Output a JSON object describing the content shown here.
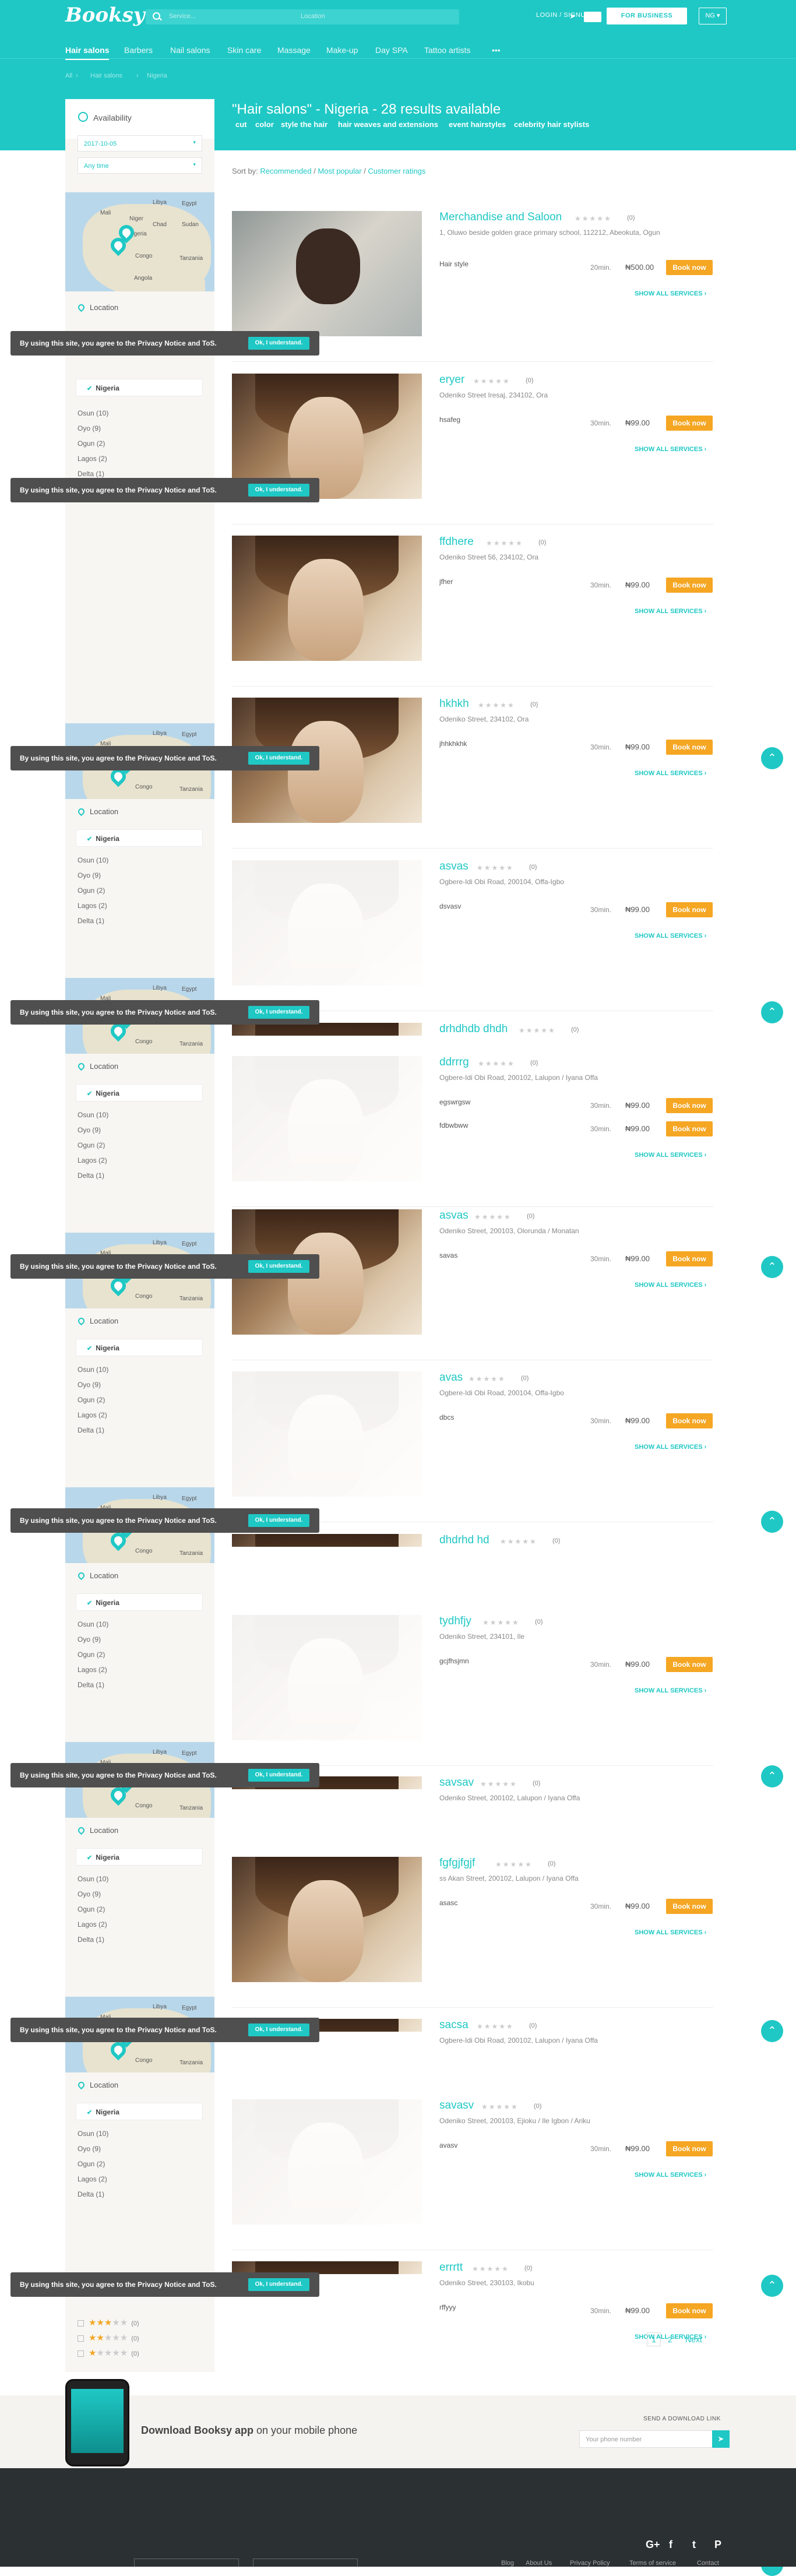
{
  "header": {
    "logo": "Booksy",
    "search_placeholder": "Service...",
    "location_placeholder": "Location",
    "login": "LOGIN / SIGNUP",
    "for_business": "FOR BUSINESS",
    "lang": "NG ▾"
  },
  "nav": [
    "Hair salons",
    "Barbers",
    "Nail salons",
    "Skin care",
    "Massage",
    "Make-up",
    "Day SPA",
    "Tattoo artists",
    "•••"
  ],
  "breadcrumb": [
    "All",
    "Hair salons",
    "Nigeria"
  ],
  "results_title": "\"Hair salons\" - Nigeria - 28 results available",
  "tags": [
    "cut",
    "color",
    "style the hair",
    "hair weaves and extensions",
    "event hairstyles",
    "celebrity hair stylists"
  ],
  "filters": {
    "availability": "Availability",
    "date": "2017-10-05",
    "time": "Any time",
    "location": "Location",
    "country": "Nigeria",
    "regions": [
      "Osun (10)",
      "Oyo (9)",
      "Ogun (2)",
      "Lagos (2)",
      "Delta (1)"
    ],
    "star_counts": [
      "(0)",
      "(0)",
      "(0)"
    ]
  },
  "map": {
    "labels": [
      "Libya",
      "Egypt",
      "Niger",
      "Chad",
      "Sudan",
      "Nigeria",
      "Congo",
      "Angola",
      "Tanzania",
      "Mali"
    ]
  },
  "sort": {
    "label": "Sort by:",
    "options": [
      "Recommended",
      "Most popular",
      "Customer ratings"
    ]
  },
  "toast": {
    "text": "By using this site, you agree to the Privacy Notice and ToS.",
    "ok": "Ok, I understand."
  },
  "listings": [
    {
      "name": "Merchandise and Saloon",
      "rating": "(0)",
      "address": "1, Oluwo beside golden grace primary school, 112212, Abeokuta, Ogun",
      "services": [
        {
          "name": "Hair style",
          "duration": "20min.",
          "price": "₦500.00"
        }
      ]
    },
    {
      "name": "eryer",
      "rating": "(0)",
      "address": "Odeniko Street Iresaj, 234102, Ora",
      "services": [
        {
          "name": "hsafeg",
          "duration": "30min.",
          "price": "₦99.00"
        }
      ]
    },
    {
      "name": "ffdhere",
      "rating": "(0)",
      "address": "Odeniko Street 56, 234102, Ora",
      "services": [
        {
          "name": "jfher",
          "duration": "30min.",
          "price": "₦99.00"
        }
      ]
    },
    {
      "name": "hkhkh",
      "rating": "(0)",
      "address": "Odeniko Street, 234102, Ora",
      "services": [
        {
          "name": "jhhkhkhk",
          "duration": "30min.",
          "price": "₦99.00"
        }
      ]
    },
    {
      "name": "asvas",
      "rating": "(0)",
      "address": "Ogbere-Idi Obi Road, 200104, Offa-Igbo",
      "services": [
        {
          "name": "dsvasv",
          "duration": "30min.",
          "price": "₦99.00"
        }
      ]
    },
    {
      "name": "drhdhdb dhdh",
      "rating": "(0)",
      "address": "",
      "services": []
    },
    {
      "name": "ddrrrg",
      "rating": "(0)",
      "address": "Ogbere-Idi Obi Road, 200102, Lalupon / Iyana Offa",
      "services": [
        {
          "name": "egswrgsw",
          "duration": "30min.",
          "price": "₦99.00"
        },
        {
          "name": "fdbwbww",
          "duration": "30min.",
          "price": "₦99.00"
        }
      ]
    },
    {
      "name": "asvas",
      "rating": "(0)",
      "address": "Odeniko Street, 200103, Olorunda / Monatan",
      "services": [
        {
          "name": "savas",
          "duration": "30min.",
          "price": "₦99.00"
        }
      ]
    },
    {
      "name": "avas",
      "rating": "(0)",
      "address": "Ogbere-Idi Obi Road, 200104, Offa-Igbo",
      "services": [
        {
          "name": "dbcs",
          "duration": "30min.",
          "price": "₦99.00"
        }
      ]
    },
    {
      "name": "dhdrhd hd",
      "rating": "(0)",
      "address": "",
      "services": []
    },
    {
      "name": "tydhfjy",
      "rating": "(0)",
      "address": "Odeniko Street, 234101, Ile",
      "services": [
        {
          "name": "gcjfhsjmn",
          "duration": "30min.",
          "price": "₦99.00"
        }
      ]
    },
    {
      "name": "savsav",
      "rating": "(0)",
      "address": "Odeniko Street, 200102, Lalupon / Iyana Offa",
      "services": []
    },
    {
      "name": "fgfgjfgjf",
      "rating": "(0)",
      "address": "ss Akan Street, 200102, Lalupon / Iyana Offa",
      "services": [
        {
          "name": "asasc",
          "duration": "30min.",
          "price": "₦99.00"
        }
      ]
    },
    {
      "name": "sacsa",
      "rating": "(0)",
      "address": "Ogbere-Idi Obi Road, 200102, Lalupon / Iyana Offa",
      "services": []
    },
    {
      "name": "savasv",
      "rating": "(0)",
      "address": "Odeniko Street, 200103, Ejioku / Ile Igbon / Ariku",
      "services": [
        {
          "name": "avasv",
          "duration": "30min.",
          "price": "₦99.00"
        }
      ]
    },
    {
      "name": "errrtt",
      "rating": "(0)",
      "address": "Odeniko Street, 230103, Ikobu",
      "services": [
        {
          "name": "rffyyy",
          "duration": "30min.",
          "price": "₦99.00"
        }
      ]
    }
  ],
  "ui": {
    "book_now": "Book now",
    "show_all": "SHOW ALL SERVICES ›",
    "top": "⌃"
  },
  "pagination": [
    "1",
    "2",
    "Next"
  ],
  "app": {
    "download": "Download Booksy app",
    "download_rest": " on your mobile phone",
    "send_label": "SEND A DOWNLOAD LINK",
    "phone_placeholder": "Your phone number"
  },
  "footer": {
    "links": [
      "Blog",
      "About Us",
      "Privacy Policy",
      "Terms of service",
      "Contact"
    ],
    "social": [
      "G+",
      "f",
      "t",
      "P"
    ]
  },
  "colors": {
    "brand": "#1fc8c5",
    "book": "#f5a623",
    "footer": "#2b3032"
  }
}
